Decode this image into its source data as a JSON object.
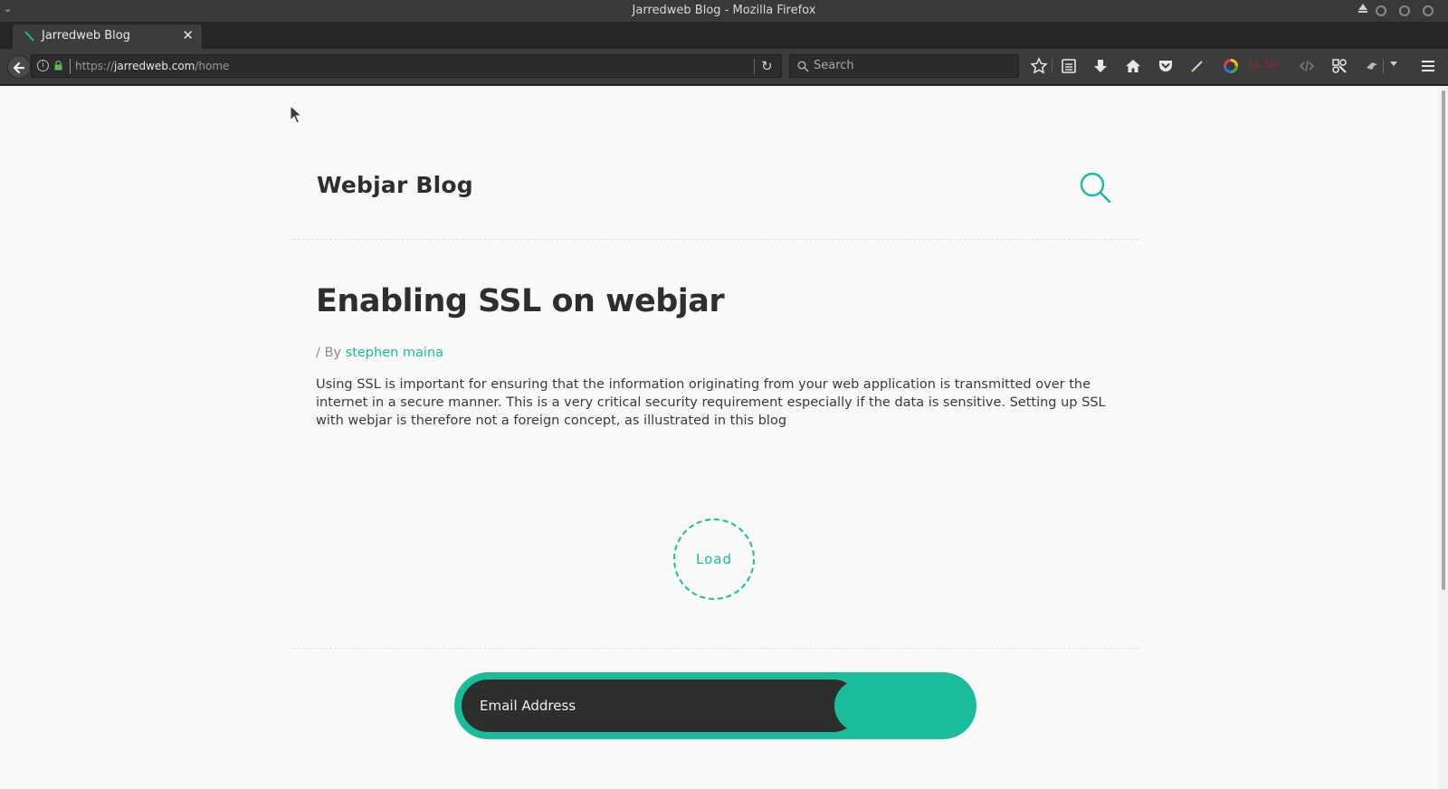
{
  "window": {
    "title": "Jarredweb Blog - Mozilla Firefox"
  },
  "tabs": [
    {
      "label": "Jarredweb Blog",
      "active": true
    }
  ],
  "navbar": {
    "url_scheme": "https://",
    "url_host": "jarredweb.com",
    "url_path": "/home",
    "search_placeholder": "Search",
    "memory_badge": "14.3M"
  },
  "page": {
    "blog_title": "Webjar Blog",
    "post": {
      "title": "Enabling SSL on webjar",
      "by_prefix": "/ By",
      "author": "stephen maina",
      "excerpt": "Using SSL is important for ensuring that the information originating from your web application is transmitted over the internet in a secure manner. This is a very critical security requirement especially if the data is sensitive. Setting up SSL with webjar is therefore not a foreign concept, as illustrated in this blog"
    },
    "load_label": "Load",
    "subscribe": {
      "email_placeholder": "Email Address"
    }
  },
  "colors": {
    "accent": "#1abc9c",
    "dark": "#2e2e2e",
    "page_bg": "#f9f9f9"
  },
  "icons": [
    "menu-chevron-icon",
    "firefox-favicon-icon",
    "close-icon",
    "plus-icon",
    "back-arrow-icon",
    "info-icon",
    "lock-icon",
    "reload-icon",
    "search-icon",
    "star-icon",
    "reading-list-icon",
    "download-icon",
    "home-icon",
    "pocket-icon",
    "pen-icon",
    "color-ring-icon",
    "code-icon",
    "tools-icon",
    "extension-icon",
    "hamburger-menu-icon"
  ]
}
